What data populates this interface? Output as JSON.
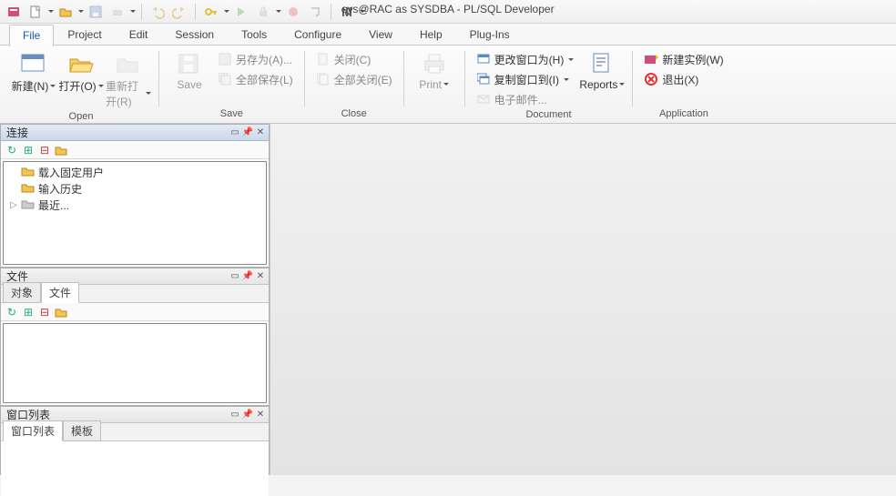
{
  "window_title": "sys@RAC as SYSDBA - PL/SQL Developer",
  "ribbon_tabs": [
    "File",
    "Project",
    "Edit",
    "Session",
    "Tools",
    "Configure",
    "View",
    "Help",
    "Plug-Ins"
  ],
  "ribbon_active": 0,
  "groups": {
    "open": {
      "label": "Open",
      "new_btn": "新建(N)",
      "open_btn": "打开(O)",
      "reopen_btn": "重新打开(R)"
    },
    "save": {
      "label": "Save",
      "save_btn": "Save",
      "saveas": "另存为(A)...",
      "saveall": "全部保存(L)"
    },
    "close": {
      "label": "Close",
      "close": "关闭(C)",
      "closeall": "全部关闭(E)"
    },
    "print": {
      "label": "",
      "print_btn": "Print"
    },
    "document": {
      "label": "Document",
      "reports_btn": "Reports",
      "changewin": "更改窗口为(H)",
      "copywin": "复制窗口到(I)",
      "email": "电子邮件..."
    },
    "application": {
      "label": "Application",
      "newinst": "新建实例(W)",
      "exit": "退出(X)"
    }
  },
  "panels": {
    "connections": {
      "title": "连接",
      "items": [
        "载入固定用户",
        "输入历史",
        "最近..."
      ]
    },
    "files": {
      "title": "文件",
      "tabs": [
        "对象",
        "文件"
      ],
      "active_tab": 1
    },
    "windows": {
      "title": "窗口列表",
      "tabs": [
        "窗口列表",
        "模板"
      ],
      "active_tab": 0
    }
  }
}
